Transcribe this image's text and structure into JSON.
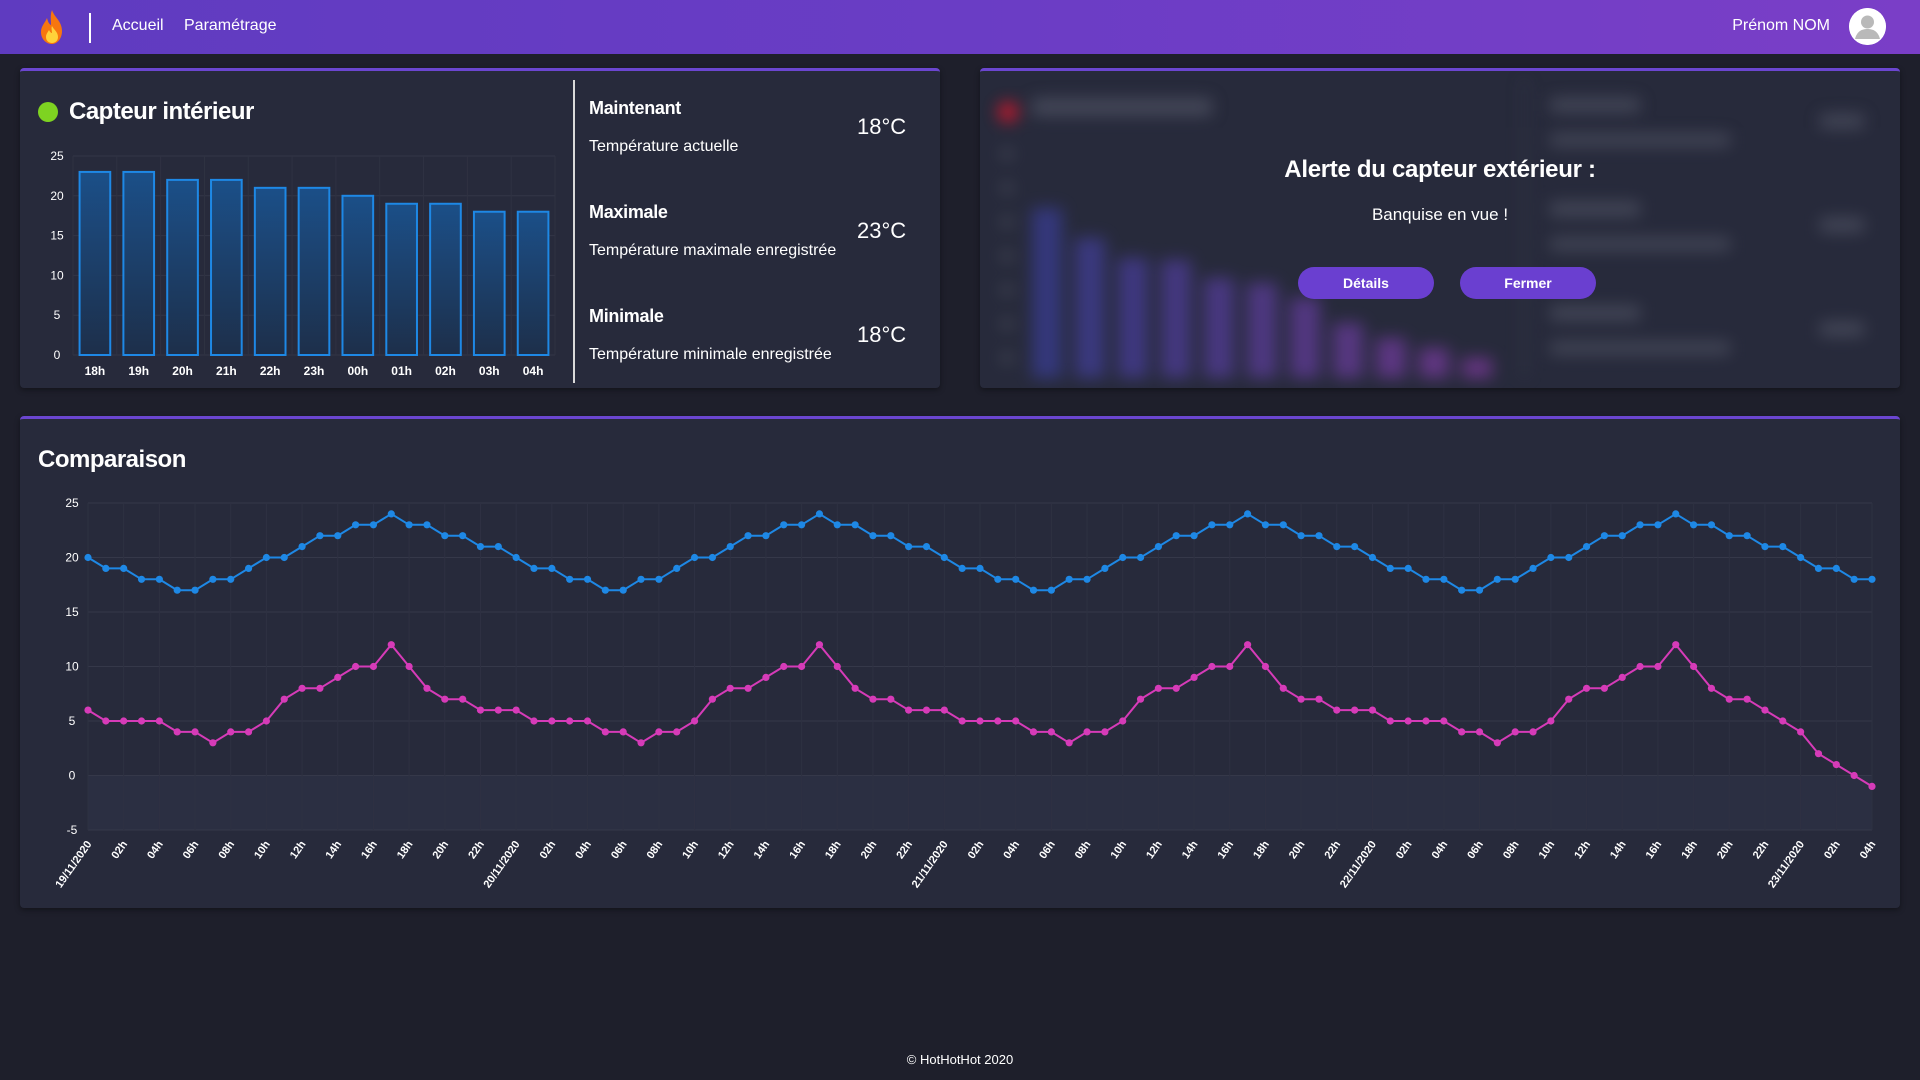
{
  "nav": {
    "home_label": "Accueil",
    "settings_label": "Paramétrage",
    "user_name": "Prénom NOM",
    "brand_icon": "flame-icon",
    "colors": {
      "bar_start": "#5f3bc0",
      "bar_end": "#7a3ec7"
    }
  },
  "indoor": {
    "title": "Capteur intérieur",
    "status_color": "#7ed321",
    "stats": [
      {
        "label": "Maintenant",
        "desc": "Température actuelle",
        "value": "18°C"
      },
      {
        "label": "Maximale",
        "desc": "Température maximale enregistrée",
        "value": "23°C"
      },
      {
        "label": "Minimale",
        "desc": "Température minimale enregistrée",
        "value": "18°C"
      }
    ]
  },
  "outdoor": {
    "status_color": "#e0162b",
    "alert_title": "Alerte du capteur extérieur :",
    "alert_message": "Banquise en vue !",
    "details_button": "Détails",
    "close_button": "Fermer"
  },
  "compare": {
    "title": "Comparaison"
  },
  "footer": {
    "text": "© HotHotHot 2020"
  },
  "chart_data": [
    {
      "type": "bar",
      "categories": [
        "18h",
        "19h",
        "20h",
        "21h",
        "22h",
        "23h",
        "00h",
        "01h",
        "02h",
        "03h",
        "04h"
      ],
      "values": [
        23,
        23,
        22,
        22,
        21,
        21,
        20,
        19,
        19,
        18,
        18
      ],
      "ylim": [
        0,
        25
      ],
      "yticks": [
        0,
        5,
        10,
        15,
        20,
        25
      ],
      "color": "#1e88e5",
      "grid": true
    },
    {
      "type": "line",
      "ylim": [
        -5,
        25
      ],
      "yticks": [
        -5,
        0,
        5,
        10,
        15,
        20,
        25
      ],
      "xlabels": [
        "19/11/2020",
        "02h",
        "04h",
        "06h",
        "08h",
        "10h",
        "12h",
        "14h",
        "16h",
        "18h",
        "20h",
        "22h",
        "20/11/2020",
        "02h",
        "04h",
        "06h",
        "08h",
        "10h",
        "12h",
        "14h",
        "16h",
        "18h",
        "20h",
        "22h",
        "21/11/2020",
        "02h",
        "04h",
        "06h",
        "08h",
        "10h",
        "12h",
        "14h",
        "16h",
        "18h",
        "20h",
        "22h",
        "22/11/2020",
        "02h",
        "04h",
        "06h",
        "08h",
        "10h",
        "12h",
        "14h",
        "16h",
        "18h",
        "20h",
        "22h",
        "23/11/2020",
        "02h",
        "04h"
      ],
      "grid": true,
      "series": [
        {
          "color": "#1e88e5",
          "values": [
            20,
            19,
            19,
            18,
            18,
            17,
            17,
            18,
            18,
            19,
            20,
            20,
            21,
            22,
            22,
            23,
            23,
            24,
            23,
            23,
            22,
            22,
            21,
            21,
            20,
            19,
            19,
            18,
            18,
            17,
            17,
            18,
            18,
            19,
            20,
            20,
            21,
            22,
            22,
            23,
            23,
            24,
            23,
            23,
            22,
            22,
            21,
            21,
            20,
            19,
            19,
            18,
            18,
            17,
            17,
            18,
            18,
            19,
            20,
            20,
            21,
            22,
            22,
            23,
            23,
            24,
            23,
            23,
            22,
            22,
            21,
            21,
            20,
            19,
            19,
            18,
            18,
            17,
            17,
            18,
            18,
            19,
            20,
            20,
            21,
            22,
            22,
            23,
            23,
            24,
            23,
            23,
            22,
            22,
            21,
            21,
            20,
            19,
            19,
            18,
            18
          ]
        },
        {
          "color": "#d63bb8",
          "values": [
            6,
            5,
            5,
            5,
            5,
            4,
            4,
            3,
            4,
            4,
            5,
            7,
            8,
            8,
            9,
            10,
            10,
            12,
            10,
            8,
            7,
            7,
            6,
            6,
            6,
            5,
            5,
            5,
            5,
            4,
            4,
            3,
            4,
            4,
            5,
            7,
            8,
            8,
            9,
            10,
            10,
            12,
            10,
            8,
            7,
            7,
            6,
            6,
            6,
            5,
            5,
            5,
            5,
            4,
            4,
            3,
            4,
            4,
            5,
            7,
            8,
            8,
            9,
            10,
            10,
            12,
            10,
            8,
            7,
            7,
            6,
            6,
            6,
            5,
            5,
            5,
            5,
            4,
            4,
            3,
            4,
            4,
            5,
            7,
            8,
            8,
            9,
            10,
            10,
            12,
            10,
            8,
            7,
            7,
            6,
            5,
            4,
            2,
            1,
            0,
            -1
          ]
        }
      ]
    }
  ]
}
